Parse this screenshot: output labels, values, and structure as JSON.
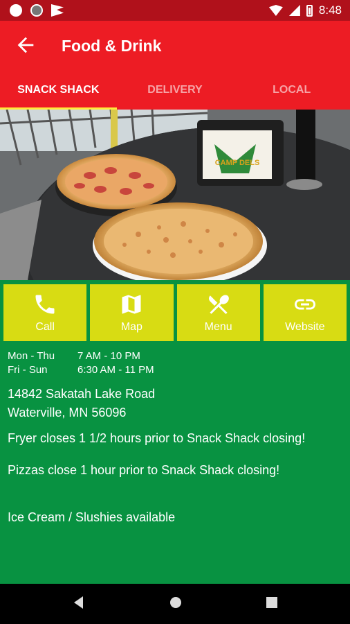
{
  "status_bar": {
    "time": "8:48"
  },
  "app_bar": {
    "title": "Food & Drink"
  },
  "tabs": [
    {
      "label": "SNACK SHACK",
      "active": true
    },
    {
      "label": "DELIVERY",
      "active": false
    },
    {
      "label": "LOCAL",
      "active": false
    }
  ],
  "hero": {
    "napkin_holder_text": "CAMP DELS"
  },
  "actions": [
    {
      "label": "Call",
      "icon": "phone-icon"
    },
    {
      "label": "Map",
      "icon": "map-icon"
    },
    {
      "label": "Menu",
      "icon": "fork-spoon-icon"
    },
    {
      "label": "Website",
      "icon": "link-icon"
    }
  ],
  "hours": [
    {
      "days": "Mon - Thu",
      "time": "7 AM - 10 PM"
    },
    {
      "days": "Fri - Sun",
      "time": "6:30 AM - 11 PM"
    }
  ],
  "address": {
    "line1": "14842 Sakatah Lake Road",
    "line2": "Waterville, MN 56096"
  },
  "notes": {
    "fryer": "Fryer closes 1 1/2 hours prior to Snack Shack closing!",
    "pizza": "Pizzas close 1 hour prior to Snack Shack closing!",
    "extras": "Ice Cream / Slushies available"
  },
  "colors": {
    "app_bar": "#ed1c24",
    "content_bg": "#089241",
    "action_bg": "#d8dc13",
    "tab_indicator": "#ffeb3b"
  }
}
